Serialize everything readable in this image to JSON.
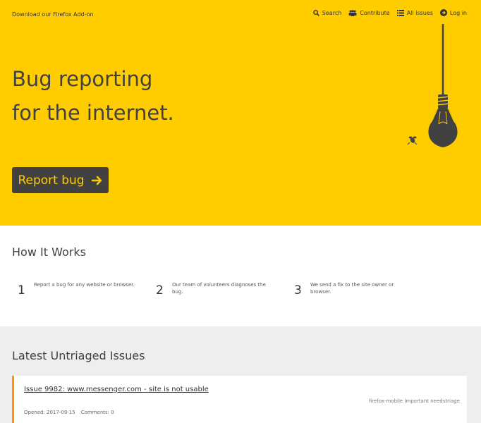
{
  "nav": {
    "addon_link": "Download our Firefox Add-on",
    "items": [
      {
        "label": "Search",
        "icon": "search-icon"
      },
      {
        "label": "Contribute",
        "icon": "people-icon"
      },
      {
        "label": "All issues",
        "icon": "list-icon"
      },
      {
        "label": "Log in",
        "icon": "arrow-circle-icon"
      }
    ]
  },
  "hero": {
    "title_line1": "Bug reporting",
    "title_line2": "for the internet.",
    "cta_label": "Report bug",
    "colors": {
      "background": "#ffcc00",
      "button": "#414141",
      "button_text": "#ffcc00"
    }
  },
  "how_it_works": {
    "heading": "How It Works",
    "steps": [
      {
        "number": "1",
        "text": "Report a bug for any website or browser."
      },
      {
        "number": "2",
        "text": "Our team of volunteers diagnoses the bug."
      },
      {
        "number": "3",
        "text": "We send a fix to the site owner or browser."
      }
    ]
  },
  "latest": {
    "heading": "Latest Untriaged Issues",
    "issues": [
      {
        "title": "Issue 9982: www.messenger.com - site is not usable",
        "labels": "firefox-mobile important needstriage",
        "opened": "Opened: 2017-09-15",
        "comments": "Comments: 0",
        "accent_color": "#ff9500"
      }
    ]
  }
}
